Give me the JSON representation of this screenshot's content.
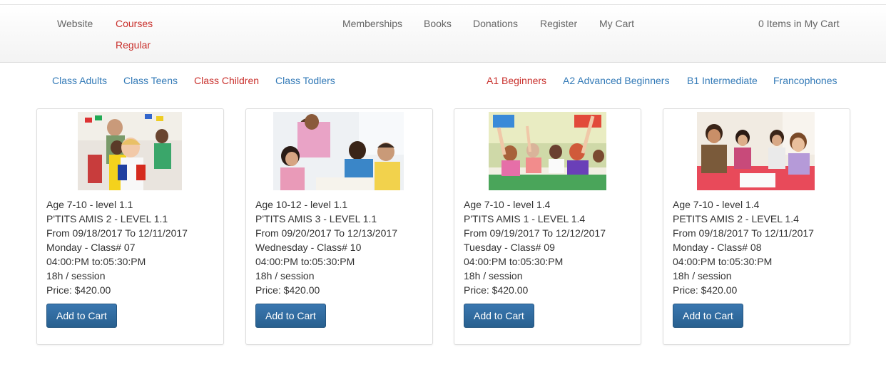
{
  "nav": {
    "website": "Website",
    "courses": "Courses",
    "regular": "Regular",
    "memberships": "Memberships",
    "books": "Books",
    "donations": "Donations",
    "register": "Register",
    "my_cart": "My Cart",
    "cart_count": "0 Items in My Cart"
  },
  "subnav": {
    "class_adults": "Class Adults",
    "class_teens": "Class Teens",
    "class_children": "Class Children",
    "class_todlers": "Class Todlers",
    "a1": "A1 Beginners",
    "a2": "A2 Advanced Beginners",
    "b1": "B1 Intermediate",
    "francophones": "Francophones"
  },
  "colors": {
    "link": "#337ab7",
    "active": "#c9302c",
    "button": "#2a6496"
  },
  "courses": [
    {
      "age": "Age 7-10 - level 1.1",
      "name": "P'TITS AMIS 2 - LEVEL 1.1",
      "dates": "From 09/18/2017 To 12/11/2017",
      "day": "Monday - Class# 07",
      "time": "04:00:PM to:05:30:PM",
      "duration": "18h / session",
      "price": "Price: $420.00",
      "button": "Add to Cart"
    },
    {
      "age": "Age 10-12 - level 1.1",
      "name": "P'TITS AMIS 3 - LEVEL 1.1",
      "dates": "From 09/20/2017 To 12/13/2017",
      "day": "Wednesday - Class# 10",
      "time": "04:00:PM to:05:30:PM",
      "duration": "18h / session",
      "price": "Price: $420.00",
      "button": "Add to Cart"
    },
    {
      "age": "Age 7-10 - level 1.4",
      "name": "P'TITS AMIS 1 - LEVEL 1.4",
      "dates": "From 09/19/2017 To 12/12/2017",
      "day": "Tuesday - Class# 09",
      "time": "04:00:PM to:05:30:PM",
      "duration": "18h / session",
      "price": "Price: $420.00",
      "button": "Add to Cart"
    },
    {
      "age": "Age 7-10 - level 1.4",
      "name": "PETITS AMIS 2 - LEVEL 1.4",
      "dates": "From 09/18/2017 To 12/11/2017",
      "day": "Monday - Class# 08",
      "time": "04:00:PM to:05:30:PM",
      "duration": "18h / session",
      "price": "Price: $420.00",
      "button": "Add to Cart"
    }
  ]
}
